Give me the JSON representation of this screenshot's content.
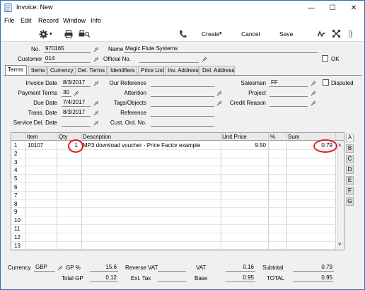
{
  "window": {
    "title": "Invoice: New",
    "controls": {
      "minimize": "—",
      "maximize": "☐",
      "close": "✕"
    }
  },
  "menu": [
    "File",
    "Edit",
    "Record",
    "Window",
    "Info"
  ],
  "toolbar": {
    "create_label": "Create",
    "cancel_label": "Cancel",
    "save_label": "Save"
  },
  "header": {
    "no_label": "No.",
    "no_value": "970165",
    "name_label": "Name",
    "name_value": "Magic Flute Systems",
    "customer_label": "Customer",
    "customer_value": "014",
    "official_label": "Official No.",
    "official_value": "",
    "ok_label": "OK"
  },
  "tabs": [
    "Terms",
    "Items",
    "Currency",
    "Del. Terms",
    "Identifiers",
    "Price List",
    "Inv. Address",
    "Del. Address"
  ],
  "terms": {
    "invoice_date_label": "Invoice Date",
    "invoice_date": "8/3/2017",
    "payment_terms_label": "Payment Terms",
    "payment_terms": "30",
    "due_date_label": "Due Date",
    "due_date": "7/4/2017",
    "trans_date_label": "Trans. Date",
    "trans_date": "8/3/2017",
    "service_del_date_label": "Service Del. Date",
    "service_del_date": "",
    "our_ref_label": "Our Reference",
    "attention_label": "Attention",
    "tags_label": "Tags/Objects",
    "reference_label": "Reference",
    "cust_ord_label": "Cust. Ord. No.",
    "salesman_label": "Salesman",
    "salesman": "FF",
    "project_label": "Project",
    "credit_reason_label": "Credit Reason",
    "disputed_label": "Disputed"
  },
  "grid": {
    "columns": [
      "Item",
      "Qty",
      "Description",
      "Unit Price",
      "%",
      "Sum"
    ],
    "rows": [
      {
        "n": "1",
        "item": "10107",
        "qty": "1",
        "desc": "MP3 download voucher - Price Factor example",
        "price": "9.50",
        "pct": "",
        "sum": "0.79"
      },
      {
        "n": "2"
      },
      {
        "n": "3"
      },
      {
        "n": "4"
      },
      {
        "n": "5"
      },
      {
        "n": "6"
      },
      {
        "n": "7"
      },
      {
        "n": "8"
      },
      {
        "n": "9"
      },
      {
        "n": "10"
      },
      {
        "n": "11"
      },
      {
        "n": "12"
      },
      {
        "n": "13"
      }
    ],
    "row_tabs": [
      "A",
      "B",
      "C",
      "D",
      "E",
      "F",
      "G"
    ]
  },
  "footer": {
    "currency_label": "Currency",
    "currency": "GBP",
    "gp_pct_label": "GP %",
    "gp_pct": "15.6",
    "total_gp_label": "Total GP",
    "total_gp": "0.12",
    "reverse_vat_label": "Reverse VAT",
    "ext_tax_label": "Ext. Tax",
    "vat_label": "VAT",
    "vat": "0.16",
    "base_label": "Base",
    "base": "0.95",
    "subtotal_label": "Subtotal",
    "subtotal": "0.79",
    "total_label": "TOTAL",
    "total": "0.95"
  },
  "colors": {
    "accent": "#2a6fb5",
    "highlight_circle": "#e02020"
  }
}
